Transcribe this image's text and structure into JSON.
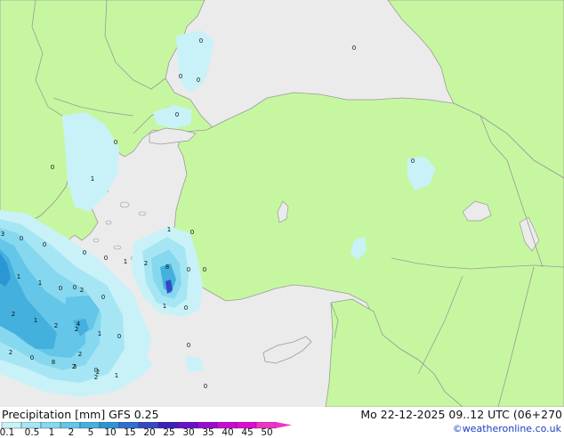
{
  "footer": {
    "title": "Precipitation [mm]  GFS 0.25",
    "datetime": "Mo 22-12-2025 09..12 UTC (06+270",
    "credit": "©weatheronline.co.uk"
  },
  "colorbar": {
    "ticks": [
      "0.1",
      "0.5",
      "1",
      "2",
      "5",
      "10",
      "15",
      "20",
      "25",
      "30",
      "35",
      "40",
      "45",
      "50"
    ],
    "colors": [
      "#c8f2f8",
      "#a6e6f4",
      "#86d8ef",
      "#64c6e8",
      "#44b0de",
      "#2c95d4",
      "#2f6fd0",
      "#3549c6",
      "#3c22bc",
      "#6a10c8",
      "#9c0ad2",
      "#c80ad8",
      "#e20ad2",
      "#f033c8"
    ]
  },
  "map": {
    "land_color": "#c6f7a0",
    "sea_color": "#ebebeb",
    "border_color": "#9a9a9a",
    "precip_colors": {
      "light": "#c8f2f8",
      "low": "#a6e6f4",
      "mid": "#86d8ef",
      "high": "#64c6e8",
      "heavy": "#44b0de",
      "peak": "#3549c6"
    },
    "value_labels": [
      "0",
      "0",
      "0",
      "0",
      "0",
      "0",
      "0",
      "1",
      "0",
      "1",
      "0",
      "0",
      "0",
      "0",
      "0",
      "1",
      "1",
      "0",
      "0",
      "0",
      "3",
      "0",
      "0",
      "0",
      "1",
      "1",
      "2",
      "2",
      "8",
      "0",
      "2",
      "2",
      "1",
      "0",
      "1",
      "2",
      "4",
      "2",
      "8",
      "2",
      "0",
      "2",
      "0",
      "2",
      "3",
      "2",
      "1",
      "0"
    ]
  }
}
